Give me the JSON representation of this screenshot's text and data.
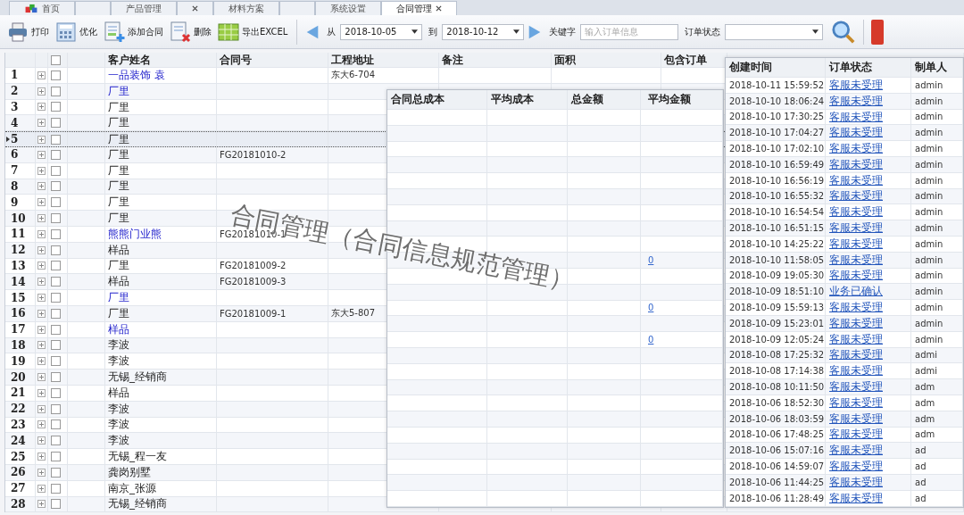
{
  "tabs": [
    {
      "label": "首页",
      "selected": false,
      "closable": false
    },
    {
      "selected": false,
      "closable": false
    },
    {
      "label": "产品管理",
      "selected": false,
      "closable": false
    },
    {
      "selected": false,
      "closable": true
    },
    {
      "label": "材料方案",
      "selected": false,
      "closable": false
    },
    {
      "selected": false,
      "closable": false
    },
    {
      "label": "系统设置",
      "selected": false,
      "closable": false
    },
    {
      "label": "合同管理",
      "selected": true,
      "closable": true
    }
  ],
  "toolbar": {
    "buttons": [
      {
        "label": "打印",
        "kind": "print"
      },
      {
        "label": "优化",
        "kind": "calc"
      },
      {
        "label": "添加合同",
        "kind": "add"
      },
      {
        "label": "删除",
        "kind": "delete"
      },
      {
        "label": "导出EXCEL",
        "kind": "excel"
      }
    ],
    "from_label": "从",
    "from_date": "2018-10-05",
    "to_label": "到",
    "to_date": "2018-10-12",
    "keyword_label": "关键字",
    "keyword_placeholder": "输入订单信息",
    "status_label": "订单状态"
  },
  "grid": {
    "all_checked": false,
    "columns": [
      "客户姓名",
      "合同号",
      "工程地址",
      "备注",
      "面积",
      "包含订单"
    ],
    "rows": [
      {
        "no": "1",
        "customer": "一品装饰 袁",
        "linked": true,
        "address": "东大6-704",
        "checked": false,
        "selected": false
      },
      {
        "no": "2",
        "customer": "厂里",
        "linked": true,
        "checked": false,
        "selected": false
      },
      {
        "no": "3",
        "customer": "厂里",
        "linked": false,
        "checked": false,
        "selected": false
      },
      {
        "no": "4",
        "customer": "厂里",
        "linked": false,
        "checked": false,
        "selected": false
      },
      {
        "no": "5",
        "customer": "厂里",
        "linked": false,
        "checked": false,
        "selected": true
      },
      {
        "no": "6",
        "customer": "厂里",
        "linked": false,
        "contract": "FG20181010-2",
        "checked": false,
        "selected": false
      },
      {
        "no": "7",
        "customer": "厂里",
        "linked": false,
        "checked": false,
        "selected": false
      },
      {
        "no": "8",
        "customer": "厂里",
        "linked": false,
        "checked": false,
        "selected": false
      },
      {
        "no": "9",
        "customer": "厂里",
        "linked": false,
        "checked": false,
        "selected": false
      },
      {
        "no": "10",
        "customer": "厂里",
        "linked": false,
        "checked": false,
        "selected": false
      },
      {
        "no": "11",
        "customer": "熊熊门业熊",
        "linked": true,
        "contract": "FG20181010-1",
        "checked": false,
        "selected": false
      },
      {
        "no": "12",
        "customer": "样品",
        "linked": false,
        "checked": false,
        "selected": false
      },
      {
        "no": "13",
        "customer": "厂里",
        "linked": false,
        "contract": "FG20181009-2",
        "checked": false,
        "selected": false
      },
      {
        "no": "14",
        "customer": "样品",
        "linked": false,
        "contract": "FG20181009-3",
        "checked": false,
        "selected": false
      },
      {
        "no": "15",
        "customer": "厂里",
        "linked": true,
        "checked": false,
        "selected": false
      },
      {
        "no": "16",
        "customer": "厂里",
        "linked": false,
        "contract": "FG20181009-1",
        "address": "东大5-807",
        "checked": false,
        "selected": false
      },
      {
        "no": "17",
        "customer": "样品",
        "linked": true,
        "checked": false,
        "selected": false
      },
      {
        "no": "18",
        "customer": "李波",
        "linked": false,
        "checked": false,
        "selected": false
      },
      {
        "no": "19",
        "customer": "李波",
        "linked": false,
        "checked": false,
        "selected": false
      },
      {
        "no": "20",
        "customer": "无锡_经销商",
        "linked": false,
        "checked": false,
        "selected": false
      },
      {
        "no": "21",
        "customer": "样品",
        "linked": false,
        "checked": false,
        "selected": false
      },
      {
        "no": "22",
        "customer": "李波",
        "linked": false,
        "checked": false,
        "selected": false
      },
      {
        "no": "23",
        "customer": "李波",
        "linked": false,
        "checked": false,
        "selected": false
      },
      {
        "no": "24",
        "customer": "李波",
        "linked": false,
        "checked": false,
        "selected": false
      },
      {
        "no": "25",
        "customer": "无锡_程一友",
        "linked": false,
        "checked": false,
        "selected": false
      },
      {
        "no": "26",
        "customer": "龚岗别墅",
        "linked": false,
        "checked": false,
        "selected": false
      },
      {
        "no": "27",
        "customer": "南京_张源",
        "linked": false,
        "checked": false,
        "selected": false
      },
      {
        "no": "28",
        "customer": "无锡_经销商",
        "linked": false,
        "checked": false,
        "selected": false
      }
    ]
  },
  "cost_panel": {
    "columns": [
      "合同总成本",
      "平均成本",
      "总金额",
      "平均金额"
    ],
    "rows": [
      {},
      {},
      {},
      {},
      {},
      {},
      {},
      {},
      {},
      {
        "avg_amount": "0"
      },
      {},
      {},
      {
        "avg_amount": "0"
      },
      {},
      {
        "avg_amount": "0"
      },
      {},
      {},
      {},
      {},
      {},
      {},
      {},
      {},
      {},
      {}
    ]
  },
  "order_panel": {
    "columns": [
      "创建时间",
      "订单状态",
      "制单人"
    ],
    "rows": [
      {
        "time": "2018-10-11 15:59:52",
        "status": "客服未受理",
        "maker": "admin"
      },
      {
        "time": "2018-10-10 18:06:24",
        "status": "客服未受理",
        "maker": "admin"
      },
      {
        "time": "2018-10-10 17:30:25",
        "status": "客服未受理",
        "maker": "admin"
      },
      {
        "time": "2018-10-10 17:04:27",
        "status": "客服未受理",
        "maker": "admin"
      },
      {
        "time": "2018-10-10 17:02:10",
        "status": "客服未受理",
        "maker": "admin"
      },
      {
        "time": "2018-10-10 16:59:49",
        "status": "客服未受理",
        "maker": "admin"
      },
      {
        "time": "2018-10-10 16:56:19",
        "status": "客服未受理",
        "maker": "admin"
      },
      {
        "time": "2018-10-10 16:55:32",
        "status": "客服未受理",
        "maker": "admin"
      },
      {
        "time": "2018-10-10 16:54:54",
        "status": "客服未受理",
        "maker": "admin"
      },
      {
        "time": "2018-10-10 16:51:15",
        "status": "客服未受理",
        "maker": "admin"
      },
      {
        "time": "2018-10-10 14:25:22",
        "status": "客服未受理",
        "maker": "admin"
      },
      {
        "time": "2018-10-10 11:58:05",
        "status": "客服未受理",
        "maker": "admin"
      },
      {
        "time": "2018-10-09 19:05:30",
        "status": "客服未受理",
        "maker": "admin"
      },
      {
        "time": "2018-10-09 18:51:10",
        "status": "业务已确认",
        "maker": "admin"
      },
      {
        "time": "2018-10-09 15:59:13",
        "status": "客服未受理",
        "maker": "admin"
      },
      {
        "time": "2018-10-09 15:23:01",
        "status": "客服未受理",
        "maker": "admin"
      },
      {
        "time": "2018-10-09 12:05:24",
        "status": "客服未受理",
        "maker": "admin"
      },
      {
        "time": "2018-10-08 17:25:32",
        "status": "客服未受理",
        "maker": "admi"
      },
      {
        "time": "2018-10-08 17:14:38",
        "status": "客服未受理",
        "maker": "admi"
      },
      {
        "time": "2018-10-08 10:11:50",
        "status": "客服未受理",
        "maker": "adm"
      },
      {
        "time": "2018-10-06 18:52:30",
        "status": "客服未受理",
        "maker": "adm"
      },
      {
        "time": "2018-10-06 18:03:59",
        "status": "客服未受理",
        "maker": "adm"
      },
      {
        "time": "2018-10-06 17:48:25",
        "status": "客服未受理",
        "maker": "adm"
      },
      {
        "time": "2018-10-06 15:07:16",
        "status": "客服未受理",
        "maker": "ad"
      },
      {
        "time": "2018-10-06 14:59:07",
        "status": "客服未受理",
        "maker": "ad"
      },
      {
        "time": "2018-10-06 11:44:25",
        "status": "客服未受理",
        "maker": "ad"
      },
      {
        "time": "2018-10-06 11:28:49",
        "status": "客服未受理",
        "maker": "ad"
      }
    ]
  },
  "caption": "合同管理（合同信息规范管理）"
}
